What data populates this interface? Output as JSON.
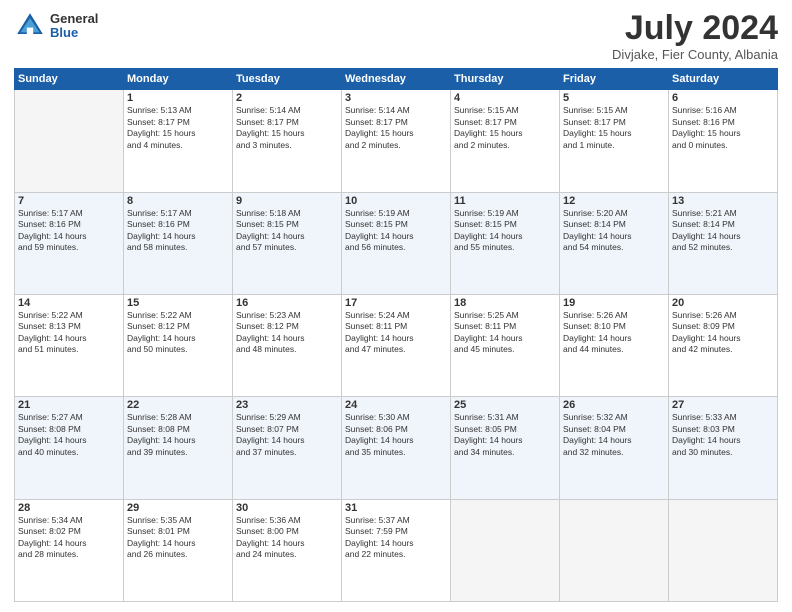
{
  "logo": {
    "general": "General",
    "blue": "Blue"
  },
  "title": "July 2024",
  "location": "Divjake, Fier County, Albania",
  "days_of_week": [
    "Sunday",
    "Monday",
    "Tuesday",
    "Wednesday",
    "Thursday",
    "Friday",
    "Saturday"
  ],
  "weeks": [
    [
      {
        "day": "",
        "info": ""
      },
      {
        "day": "1",
        "info": "Sunrise: 5:13 AM\nSunset: 8:17 PM\nDaylight: 15 hours\nand 4 minutes."
      },
      {
        "day": "2",
        "info": "Sunrise: 5:14 AM\nSunset: 8:17 PM\nDaylight: 15 hours\nand 3 minutes."
      },
      {
        "day": "3",
        "info": "Sunrise: 5:14 AM\nSunset: 8:17 PM\nDaylight: 15 hours\nand 2 minutes."
      },
      {
        "day": "4",
        "info": "Sunrise: 5:15 AM\nSunset: 8:17 PM\nDaylight: 15 hours\nand 2 minutes."
      },
      {
        "day": "5",
        "info": "Sunrise: 5:15 AM\nSunset: 8:17 PM\nDaylight: 15 hours\nand 1 minute."
      },
      {
        "day": "6",
        "info": "Sunrise: 5:16 AM\nSunset: 8:16 PM\nDaylight: 15 hours\nand 0 minutes."
      }
    ],
    [
      {
        "day": "7",
        "info": "Sunrise: 5:17 AM\nSunset: 8:16 PM\nDaylight: 14 hours\nand 59 minutes."
      },
      {
        "day": "8",
        "info": "Sunrise: 5:17 AM\nSunset: 8:16 PM\nDaylight: 14 hours\nand 58 minutes."
      },
      {
        "day": "9",
        "info": "Sunrise: 5:18 AM\nSunset: 8:15 PM\nDaylight: 14 hours\nand 57 minutes."
      },
      {
        "day": "10",
        "info": "Sunrise: 5:19 AM\nSunset: 8:15 PM\nDaylight: 14 hours\nand 56 minutes."
      },
      {
        "day": "11",
        "info": "Sunrise: 5:19 AM\nSunset: 8:15 PM\nDaylight: 14 hours\nand 55 minutes."
      },
      {
        "day": "12",
        "info": "Sunrise: 5:20 AM\nSunset: 8:14 PM\nDaylight: 14 hours\nand 54 minutes."
      },
      {
        "day": "13",
        "info": "Sunrise: 5:21 AM\nSunset: 8:14 PM\nDaylight: 14 hours\nand 52 minutes."
      }
    ],
    [
      {
        "day": "14",
        "info": "Sunrise: 5:22 AM\nSunset: 8:13 PM\nDaylight: 14 hours\nand 51 minutes."
      },
      {
        "day": "15",
        "info": "Sunrise: 5:22 AM\nSunset: 8:12 PM\nDaylight: 14 hours\nand 50 minutes."
      },
      {
        "day": "16",
        "info": "Sunrise: 5:23 AM\nSunset: 8:12 PM\nDaylight: 14 hours\nand 48 minutes."
      },
      {
        "day": "17",
        "info": "Sunrise: 5:24 AM\nSunset: 8:11 PM\nDaylight: 14 hours\nand 47 minutes."
      },
      {
        "day": "18",
        "info": "Sunrise: 5:25 AM\nSunset: 8:11 PM\nDaylight: 14 hours\nand 45 minutes."
      },
      {
        "day": "19",
        "info": "Sunrise: 5:26 AM\nSunset: 8:10 PM\nDaylight: 14 hours\nand 44 minutes."
      },
      {
        "day": "20",
        "info": "Sunrise: 5:26 AM\nSunset: 8:09 PM\nDaylight: 14 hours\nand 42 minutes."
      }
    ],
    [
      {
        "day": "21",
        "info": "Sunrise: 5:27 AM\nSunset: 8:08 PM\nDaylight: 14 hours\nand 40 minutes."
      },
      {
        "day": "22",
        "info": "Sunrise: 5:28 AM\nSunset: 8:08 PM\nDaylight: 14 hours\nand 39 minutes."
      },
      {
        "day": "23",
        "info": "Sunrise: 5:29 AM\nSunset: 8:07 PM\nDaylight: 14 hours\nand 37 minutes."
      },
      {
        "day": "24",
        "info": "Sunrise: 5:30 AM\nSunset: 8:06 PM\nDaylight: 14 hours\nand 35 minutes."
      },
      {
        "day": "25",
        "info": "Sunrise: 5:31 AM\nSunset: 8:05 PM\nDaylight: 14 hours\nand 34 minutes."
      },
      {
        "day": "26",
        "info": "Sunrise: 5:32 AM\nSunset: 8:04 PM\nDaylight: 14 hours\nand 32 minutes."
      },
      {
        "day": "27",
        "info": "Sunrise: 5:33 AM\nSunset: 8:03 PM\nDaylight: 14 hours\nand 30 minutes."
      }
    ],
    [
      {
        "day": "28",
        "info": "Sunrise: 5:34 AM\nSunset: 8:02 PM\nDaylight: 14 hours\nand 28 minutes."
      },
      {
        "day": "29",
        "info": "Sunrise: 5:35 AM\nSunset: 8:01 PM\nDaylight: 14 hours\nand 26 minutes."
      },
      {
        "day": "30",
        "info": "Sunrise: 5:36 AM\nSunset: 8:00 PM\nDaylight: 14 hours\nand 24 minutes."
      },
      {
        "day": "31",
        "info": "Sunrise: 5:37 AM\nSunset: 7:59 PM\nDaylight: 14 hours\nand 22 minutes."
      },
      {
        "day": "",
        "info": ""
      },
      {
        "day": "",
        "info": ""
      },
      {
        "day": "",
        "info": ""
      }
    ]
  ]
}
